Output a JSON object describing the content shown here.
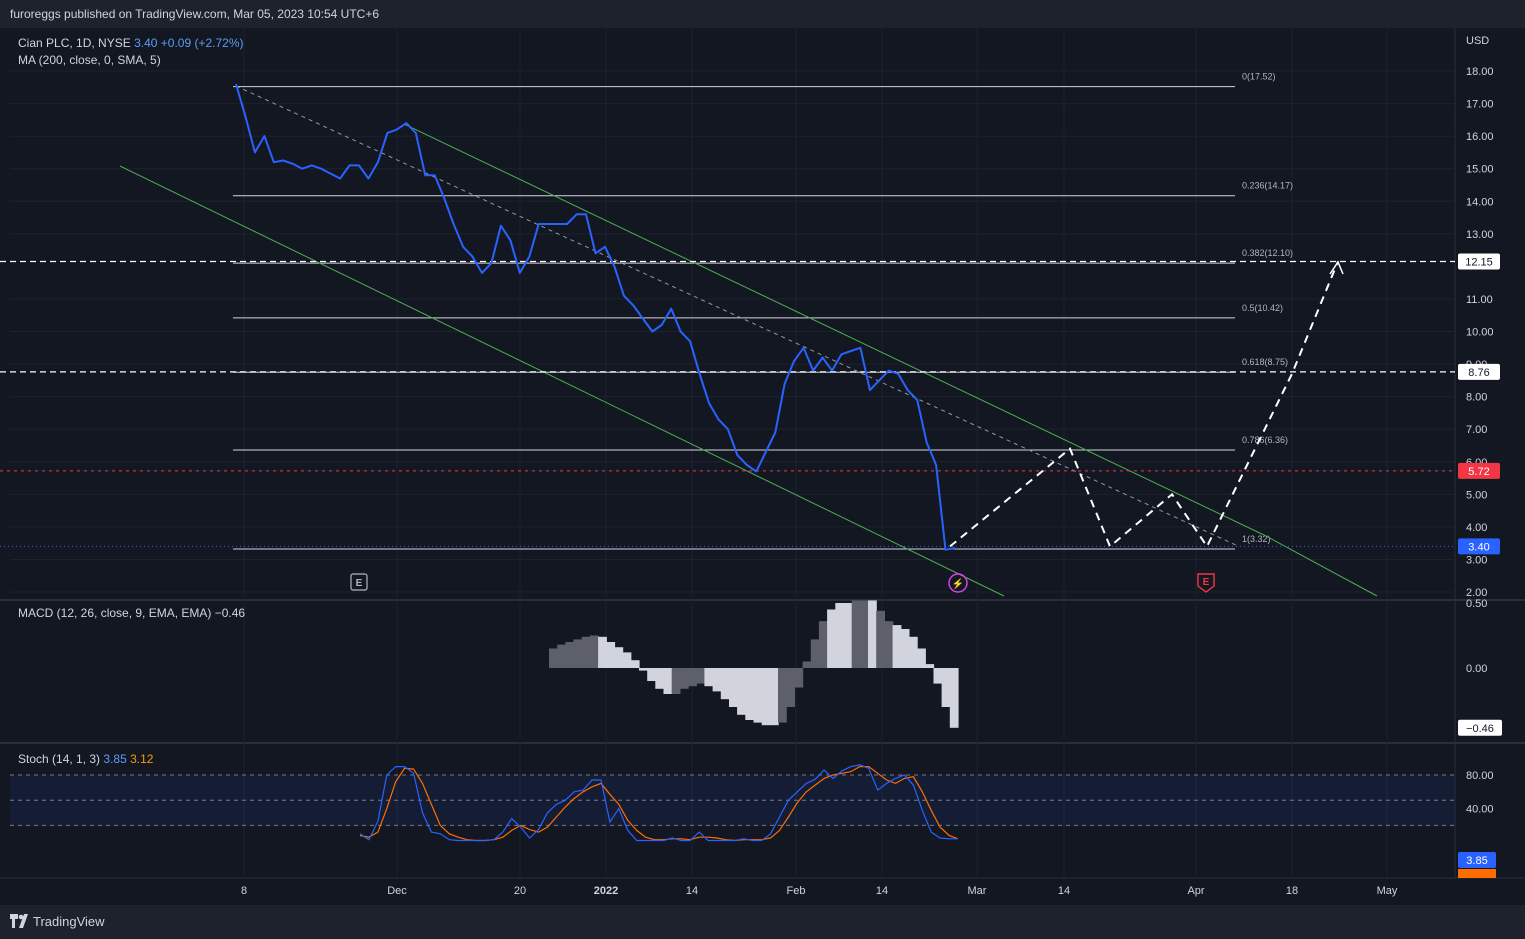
{
  "header": {
    "publish_text": "furoreggs published on TradingView.com, Mar 05, 2023 10:54 UTC+6"
  },
  "footer": {
    "brand": "TradingView",
    "logo_icon": "tradingview-logo-icon"
  },
  "legend": {
    "symbol": "Cian PLC, 1D, NYSE",
    "price": "3.40",
    "change": "+0.09 (+2.72%)",
    "ma": "MA (200, close, 0, SMA, 5)",
    "macd": "MACD (12, 26, close, 9, EMA, EMA)",
    "macd_value": "−0.46",
    "stoch": "Stoch (14, 1, 3)",
    "stoch_k": "3.85",
    "stoch_d": "3.12"
  },
  "colors": {
    "background": "#131722",
    "price_line": "#2962ff",
    "channel": "#4caf50",
    "macd_dark": "#5d606b",
    "macd_light": "#d1d4dc",
    "stoch_k": "#2962ff",
    "stoch_d": "#ff6d00",
    "last_price_badge": "#2962ff",
    "ma_badge": "#f23645"
  },
  "chart_data": {
    "type": "line",
    "currency": "USD",
    "x_axis_labels": [
      "8",
      "Dec",
      "20",
      "2022",
      "14",
      "Feb",
      "14",
      "Mar",
      "14",
      "Apr",
      "18",
      "May"
    ],
    "y_axis_labels": [
      "18.00",
      "17.00",
      "16.00",
      "15.00",
      "14.00",
      "13.00",
      "11.00",
      "10.00",
      "9.00",
      "8.00",
      "7.00",
      "6.00",
      "5.00",
      "4.00",
      "3.00",
      "2.00"
    ],
    "ylim": [
      2,
      18
    ],
    "price_series": [
      17.6,
      16.6,
      15.5,
      16.0,
      15.2,
      15.25,
      15.15,
      15.0,
      15.1,
      15.0,
      14.85,
      14.7,
      15.1,
      15.1,
      14.7,
      15.2,
      16.1,
      16.2,
      16.4,
      16.1,
      14.8,
      14.8,
      14.1,
      13.3,
      12.6,
      12.3,
      11.8,
      12.1,
      13.25,
      12.8,
      11.8,
      12.3,
      13.3,
      13.3,
      13.3,
      13.3,
      13.6,
      13.6,
      12.4,
      12.6,
      12.0,
      11.1,
      10.8,
      10.4,
      10.0,
      10.2,
      10.7,
      10.0,
      9.7,
      8.7,
      7.8,
      7.3,
      7.0,
      6.2,
      5.9,
      5.7,
      6.3,
      6.9,
      8.4,
      9.1,
      9.5,
      8.8,
      9.2,
      8.8,
      9.3,
      9.4,
      9.5,
      8.2,
      8.5,
      8.8,
      8.7,
      8.2,
      7.9,
      6.6,
      5.9,
      3.3,
      3.35
    ],
    "price_end_label": "3.40",
    "fibonacci": [
      {
        "label": "0(17.52)",
        "value": 17.52
      },
      {
        "label": "0.236(14.17)",
        "value": 14.17
      },
      {
        "label": "0.382(12.10)",
        "value": 12.1
      },
      {
        "label": "0.5(10.42)",
        "value": 10.42
      },
      {
        "label": "0.618(8.75)",
        "value": 8.75
      },
      {
        "label": "0.786(6.36)",
        "value": 6.36
      },
      {
        "label": "1(3.32)",
        "value": 3.32
      }
    ],
    "horizontal_levels": [
      {
        "label": "12.15",
        "value": 12.15,
        "style": "dashed"
      },
      {
        "label": "8.76",
        "value": 8.76,
        "style": "dashed"
      },
      {
        "label": "5.72",
        "value": 5.72,
        "style": "ma"
      },
      {
        "label": "3.40",
        "value": 3.4,
        "style": "last"
      }
    ],
    "projection_path": [
      3.4,
      6.4,
      3.4,
      5.0,
      3.4,
      8.7,
      12.15
    ],
    "event_markers": [
      {
        "type": "earnings",
        "label": "E",
        "icon": "earnings-icon"
      },
      {
        "type": "split",
        "label": "⚡",
        "icon": "lightning-icon"
      },
      {
        "type": "earnings-upcoming",
        "label": "E",
        "icon": "earnings-icon"
      }
    ],
    "macd": {
      "axis_labels": [
        "0.50",
        "0.00",
        "−0.46"
      ],
      "range": [
        -0.6,
        0.55
      ],
      "histogram": [
        0.15,
        0.18,
        0.2,
        0.22,
        0.24,
        0.25,
        0.24,
        0.2,
        0.16,
        0.12,
        0.06,
        -0.02,
        -0.1,
        -0.16,
        -0.2,
        -0.2,
        -0.16,
        -0.14,
        -0.12,
        -0.14,
        -0.18,
        -0.24,
        -0.3,
        -0.36,
        -0.4,
        -0.42,
        -0.44,
        -0.44,
        -0.42,
        -0.3,
        -0.15,
        0.05,
        0.22,
        0.36,
        0.45,
        0.5,
        0.5,
        0.52,
        0.52,
        0.52,
        0.44,
        0.36,
        0.33,
        0.3,
        0.24,
        0.15,
        0.03,
        -0.12,
        -0.3,
        -0.46
      ],
      "dark_ranges": [
        [
          0,
          5
        ],
        [
          15,
          18
        ],
        [
          28,
          33
        ],
        [
          37,
          38
        ],
        [
          40,
          41
        ]
      ]
    },
    "stoch": {
      "axis_labels": [
        "80.00",
        "40.00"
      ],
      "k_value": "3.85",
      "d_value": "3.12",
      "k": [
        10,
        3,
        25,
        80,
        90,
        90,
        82,
        35,
        12,
        10,
        3,
        2,
        2,
        2,
        2,
        3,
        12,
        28,
        18,
        5,
        15,
        35,
        45,
        50,
        60,
        62,
        74,
        74,
        24,
        40,
        14,
        2,
        2,
        2,
        2,
        5,
        2,
        2,
        12,
        2,
        2,
        2,
        2,
        4,
        2,
        2,
        10,
        30,
        50,
        60,
        70,
        75,
        86,
        76,
        85,
        90,
        92,
        88,
        62,
        70,
        76,
        80,
        68,
        38,
        12,
        5,
        4,
        4
      ],
      "d": [
        8,
        6,
        12,
        40,
        72,
        88,
        87,
        70,
        45,
        20,
        10,
        6,
        3,
        2,
        2,
        3,
        6,
        14,
        20,
        15,
        12,
        18,
        30,
        42,
        52,
        60,
        66,
        70,
        57,
        45,
        26,
        14,
        6,
        3,
        3,
        4,
        4,
        3,
        6,
        6,
        5,
        3,
        2,
        3,
        3,
        3,
        5,
        14,
        30,
        47,
        60,
        68,
        76,
        80,
        82,
        84,
        90,
        90,
        82,
        74,
        70,
        76,
        78,
        60,
        38,
        18,
        8,
        4
      ]
    }
  }
}
